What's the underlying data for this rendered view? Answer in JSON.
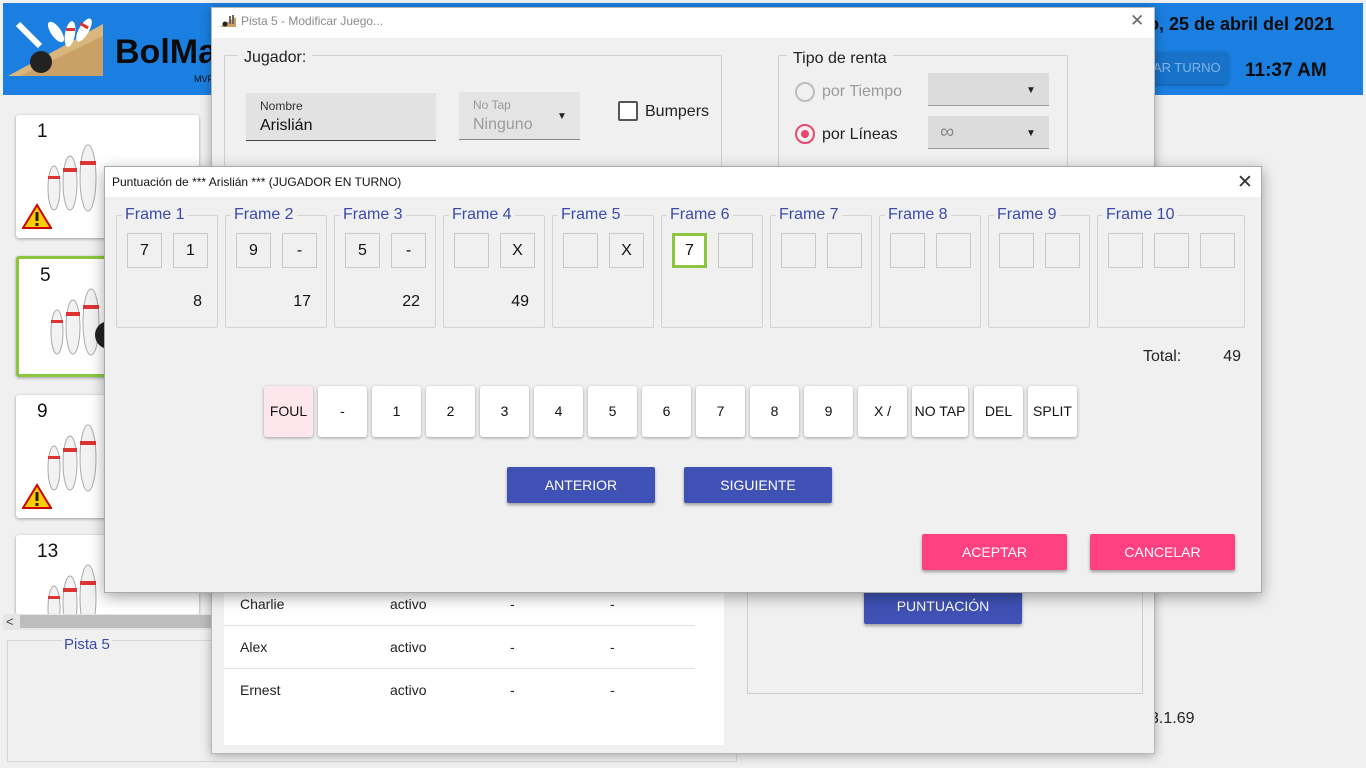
{
  "app": {
    "brand": "BolMa",
    "brand_sub": "MVF",
    "date": "o, 25 de abril del 2021",
    "turno_button": "AR TURNO",
    "clock": "11:37 AM",
    "lane_cards": [
      {
        "number": "1",
        "warning": true
      },
      {
        "number": "5",
        "warning": false,
        "selected": true
      },
      {
        "number": "9",
        "warning": true
      },
      {
        "number": "13",
        "warning": false
      }
    ],
    "pista_label": "Pista 5",
    "version": "3.1.69"
  },
  "edit_window": {
    "title": "Pista 5 - Modificar Juego...",
    "jugador_group": "Jugador:",
    "nombre_label": "Nombre",
    "nombre_value": "Arislián",
    "notap_label": "No Tap",
    "notap_value": "Ninguno",
    "bumpers_label": "Bumpers",
    "bumpers_checked": false,
    "renta_group": "Tipo de renta",
    "renta_tiempo": "por Tiempo",
    "renta_lineas": "por Líneas",
    "renta_selected": "por Líneas",
    "lineas_value": "∞",
    "players": [
      {
        "name": "Charlie",
        "status": "activo",
        "c3": "-",
        "c4": "-"
      },
      {
        "name": "Alex",
        "status": "activo",
        "c3": "-",
        "c4": "-"
      },
      {
        "name": "Ernest",
        "status": "activo",
        "c3": "-",
        "c4": "-"
      }
    ],
    "puntuacion_button": "PUNTUACIÓN"
  },
  "score_dialog": {
    "title": "Puntuación de  *** Arislián *** (JUGADOR EN TURNO)",
    "frames": [
      {
        "label": "Frame 1",
        "balls": [
          "7",
          "1"
        ],
        "total": "8"
      },
      {
        "label": "Frame 2",
        "balls": [
          "9",
          "-"
        ],
        "total": "17"
      },
      {
        "label": "Frame 3",
        "balls": [
          "5",
          "-"
        ],
        "total": "22"
      },
      {
        "label": "Frame 4",
        "balls": [
          "",
          "X"
        ],
        "total": "49"
      },
      {
        "label": "Frame 5",
        "balls": [
          "",
          "X"
        ],
        "total": ""
      },
      {
        "label": "Frame 6",
        "balls": [
          "7",
          ""
        ],
        "total": ""
      },
      {
        "label": "Frame 7",
        "balls": [
          "",
          ""
        ],
        "total": ""
      },
      {
        "label": "Frame 8",
        "balls": [
          "",
          ""
        ],
        "total": ""
      },
      {
        "label": "Frame 9",
        "balls": [
          "",
          ""
        ],
        "total": ""
      },
      {
        "label": "Frame 10",
        "balls": [
          "",
          "",
          ""
        ],
        "total": ""
      }
    ],
    "total_label": "Total:",
    "total_value": "49",
    "keys": [
      "FOUL",
      "-",
      "1",
      "2",
      "3",
      "4",
      "5",
      "6",
      "7",
      "8",
      "9",
      "X /",
      "NO TAP",
      "DEL",
      "SPLIT"
    ],
    "anterior_button": "ANTERIOR",
    "siguiente_button": "SIGUIENTE",
    "aceptar_button": "ACEPTAR",
    "cancelar_button": "CANCELAR"
  },
  "colors": {
    "header_blue": "#1a7fe0",
    "indigo": "#3f51b5",
    "pink": "#ff4081",
    "active_green": "#8cc63f",
    "frame_title": "#3a4bab"
  }
}
